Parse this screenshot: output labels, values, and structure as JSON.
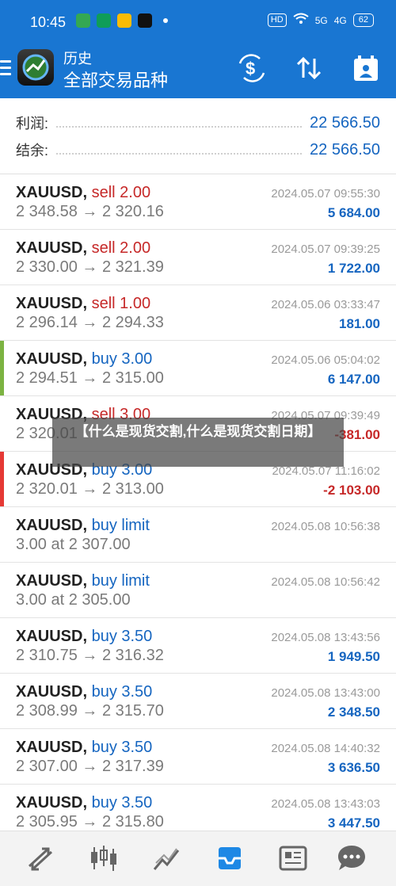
{
  "status_bar": {
    "time": "10:45",
    "hd_label": "HD",
    "signal1": "5G",
    "signal2": "4G",
    "battery": "62"
  },
  "header": {
    "title": "历史",
    "subtitle": "全部交易品种"
  },
  "summary": {
    "profit_label": "利润:",
    "profit_value": "22 566.50",
    "balance_label": "结余:",
    "balance_value": "22 566.50"
  },
  "trades": [
    {
      "symbol": "XAUUSD,",
      "action": "sell 2.00",
      "side": "sell",
      "prices": "2 348.58 → 2 320.16",
      "date": "2024.05.07 09:55:30",
      "profit": "5 684.00",
      "profit_sign": "pos",
      "marker": ""
    },
    {
      "symbol": "XAUUSD,",
      "action": "sell 2.00",
      "side": "sell",
      "prices": "2 330.00 → 2 321.39",
      "date": "2024.05.07 09:39:25",
      "profit": "1 722.00",
      "profit_sign": "pos",
      "marker": ""
    },
    {
      "symbol": "XAUUSD,",
      "action": "sell 1.00",
      "side": "sell",
      "prices": "2 296.14 → 2 294.33",
      "date": "2024.05.06 03:33:47",
      "profit": "181.00",
      "profit_sign": "pos",
      "marker": ""
    },
    {
      "symbol": "XAUUSD,",
      "action": "buy 3.00",
      "side": "buy",
      "prices": "2 294.51 → 2 315.00",
      "date": "2024.05.06 05:04:02",
      "profit": "6 147.00",
      "profit_sign": "pos",
      "marker": "#7cb342"
    },
    {
      "symbol": "XAUUSD,",
      "action": "sell 3.00",
      "side": "sell",
      "prices": "2 320.01",
      "date": "2024.05.07 09:39:49",
      "profit": "-381.00",
      "profit_sign": "neg",
      "marker": ""
    },
    {
      "symbol": "XAUUSD,",
      "action": "buy 3.00",
      "side": "buy",
      "prices": "2 320.01 → 2 313.00",
      "date": "2024.05.07 11:16:02",
      "profit": "-2 103.00",
      "profit_sign": "neg",
      "marker": "#e53935"
    },
    {
      "symbol": "XAUUSD,",
      "action": "buy limit",
      "side": "buy",
      "prices": "3.00 at 2 307.00",
      "date": "2024.05.08 10:56:38",
      "profit": "",
      "profit_sign": "pos",
      "marker": ""
    },
    {
      "symbol": "XAUUSD,",
      "action": "buy limit",
      "side": "buy",
      "prices": "3.00 at 2 305.00",
      "date": "2024.05.08 10:56:42",
      "profit": "",
      "profit_sign": "pos",
      "marker": ""
    },
    {
      "symbol": "XAUUSD,",
      "action": "buy 3.50",
      "side": "buy",
      "prices": "2 310.75 → 2 316.32",
      "date": "2024.05.08 13:43:56",
      "profit": "1 949.50",
      "profit_sign": "pos",
      "marker": ""
    },
    {
      "symbol": "XAUUSD,",
      "action": "buy 3.50",
      "side": "buy",
      "prices": "2 308.99 → 2 315.70",
      "date": "2024.05.08 13:43:00",
      "profit": "2 348.50",
      "profit_sign": "pos",
      "marker": ""
    },
    {
      "symbol": "XAUUSD,",
      "action": "buy 3.50",
      "side": "buy",
      "prices": "2 307.00 → 2 317.39",
      "date": "2024.05.08 14:40:32",
      "profit": "3 636.50",
      "profit_sign": "pos",
      "marker": ""
    },
    {
      "symbol": "XAUUSD,",
      "action": "buy 3.50",
      "side": "buy",
      "prices": "2 305.95 → 2 315.80",
      "date": "2024.05.08 13:43:03",
      "profit": "3 447.50",
      "profit_sign": "pos",
      "marker": ""
    }
  ],
  "overlay": {
    "text": "【什么是现货交割,什么是现货交割日期】"
  },
  "icons": {
    "menu": "menu-icon",
    "deposit": "dollar-exchange-icon",
    "sort": "sort-icon",
    "calendar": "calendar-icon",
    "nav": [
      "trade-icon",
      "quotes-icon",
      "chart-icon",
      "history-icon",
      "news-icon",
      "chat-icon"
    ]
  },
  "colors": {
    "primary": "#1976d2",
    "value_blue": "#1565c0",
    "loss_red": "#c62828",
    "active_nav": "#1e88e5"
  }
}
